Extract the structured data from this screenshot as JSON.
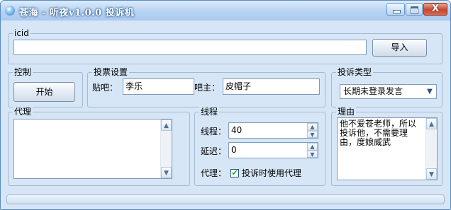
{
  "window": {
    "title": "苍海 - 听夜v1.0.0  投诉机",
    "icon": "app-icon",
    "controls": {
      "minimize": "minimize-icon",
      "maximize": "maximize-icon",
      "close_glyph": "X"
    }
  },
  "icid_group": {
    "label": "icid",
    "input_value": "",
    "import_button": "导入"
  },
  "control_group": {
    "label": "控制",
    "start_button": "开始"
  },
  "vote_group": {
    "label": "投票设置",
    "tieba_label": "贴吧：",
    "tieba_value": "李乐",
    "owner_label": "吧主：",
    "owner_value": "皮帽子"
  },
  "complaint_type_group": {
    "label": "投诉类型",
    "selected": "长期未登录发言"
  },
  "proxy_group": {
    "label": "代理",
    "content": ""
  },
  "thread_group": {
    "label": "线程",
    "threads_label": "线程：",
    "threads_value": "40",
    "delay_label": "延迟：",
    "delay_value": "0",
    "proxy_label": "代理：",
    "proxy_checkbox_label": "投诉时使用代理",
    "proxy_checked": true
  },
  "reason_group": {
    "label": "理由",
    "text": "他不爱苍老师，所以投诉他，不需要理由，度娘威武"
  },
  "colors": {
    "title_bar": "#b7d3f1",
    "window_bg": "#d6e6f6",
    "close_button": "#c8452f",
    "check_mark": "#21a121"
  }
}
